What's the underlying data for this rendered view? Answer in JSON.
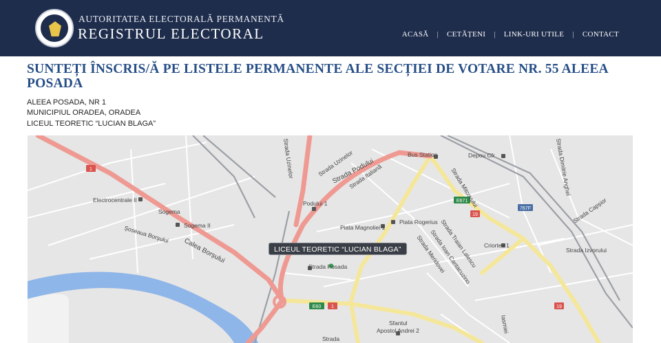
{
  "header": {
    "org_line1": "AUTORITATEA ELECTORALĂ PERMANENTĂ",
    "org_line2": "REGISTRUL ELECTORAL",
    "nav": [
      "ACASĂ",
      "CETĂȚENI",
      "LINK-URI UTILE",
      "CONTACT"
    ],
    "nav_separator": "|"
  },
  "main": {
    "title": "SUNTEȚI ÎNSCRIS/Ă PE LISTELE PERMANENTE ALE SECȚIEI DE VOTARE NR. 55 ALEEA POSADA",
    "address_line1": "ALEEA POSADA, NR 1",
    "address_line2": "MUNICIPIUL ORADEA, ORADEA",
    "address_line3": "LICEUL TEORETIC “LUCIAN BLAGA”"
  },
  "map": {
    "marker_label": "LICEUL TEORETIC “LUCIAN BLAGA”",
    "place_labels": {
      "electrocentrale": "Electrocentrale II",
      "sogema": "Sogema",
      "sogema2": "Sogema II",
      "soseaua": "Șoseaua Borșului",
      "calea": "Calea Borșului",
      "podului1": "Podului 1",
      "strada_podului": "Strada Podului",
      "strada_uzinelor": "Strada Uzinelor",
      "strada_italiana": "Strada Italiană",
      "bus_station": "Bus Station",
      "depou": "Depou Cfr",
      "piata_magnoliei": "Piata Magnoliei 1",
      "piata_rogerius": "Piata Rogerius",
      "strada_posada": "Strada Posada",
      "strada_mitcovului": "Strada Mitcovului",
      "strada_traian": "Strada Traian Lalescu",
      "strada_ioan": "Strada Ioan Cantacuzino",
      "strada_meridovei": "Strada Meridovei",
      "criortex": "Criortex 1",
      "strada_izvorului": "Strada Izvorului",
      "strada_caprior": "Strada Capșior",
      "strada_dimitrie": "Strada Dimitrie Anghel",
      "sfantul": "Sfantul",
      "apostol": "Apostol Andrei 2",
      "strada_bottom": "Strada",
      "iasmiei": "Iasmiei",
      "uzinelor_short": "Strada Uzinelor",
      "shield_e671": "E671",
      "shield_19": "19",
      "shield_767f": "767F",
      "shield_e60": "E60",
      "shield_1": "1"
    }
  }
}
